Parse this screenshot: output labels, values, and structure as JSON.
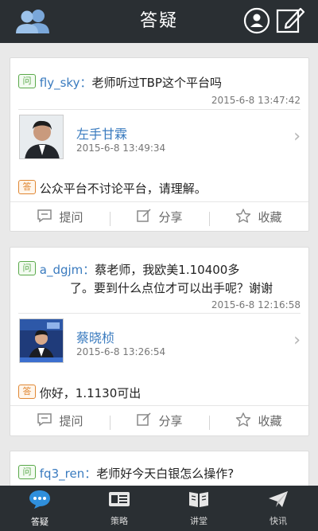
{
  "header": {
    "title": "答疑"
  },
  "posts": [
    {
      "q_user": "fly_sky：",
      "q_text": "老师听过TBP这个平台吗",
      "q_text_2": "",
      "q_time": "2015-6-8 13:47:42",
      "teacher_name": "左手甘霖",
      "a_time": "2015-6-8 13:49:34",
      "answer": "公众平台不讨论平台，请理解。"
    },
    {
      "q_user": "a_dgjm：",
      "q_text": "蔡老师，我欧美1.10400多",
      "q_text_2": "了。要到什么点位才可以出手呢？谢谢",
      "q_time": "2015-6-8 12:16:58",
      "teacher_name": "蔡晓桢",
      "a_time": "2015-6-8 13:26:54",
      "answer": "你好，1.1130可出"
    },
    {
      "q_user": "fq3_ren：",
      "q_text": "老师好今天白银怎么操作?"
    }
  ],
  "labels": {
    "question_badge": "问",
    "answer_badge": "答"
  },
  "actions": {
    "ask": "提问",
    "share": "分享",
    "favorite": "收藏"
  },
  "tabs": [
    {
      "label": "答疑",
      "icon": "chat-bubble-icon"
    },
    {
      "label": "策略",
      "icon": "strategy-card-icon"
    },
    {
      "label": "讲堂",
      "icon": "book-icon"
    },
    {
      "label": "快讯",
      "icon": "paper-plane-icon"
    }
  ],
  "colors": {
    "header": "#2a2f33",
    "accent": "#2f8fdc",
    "user": "#3a7bbf"
  }
}
